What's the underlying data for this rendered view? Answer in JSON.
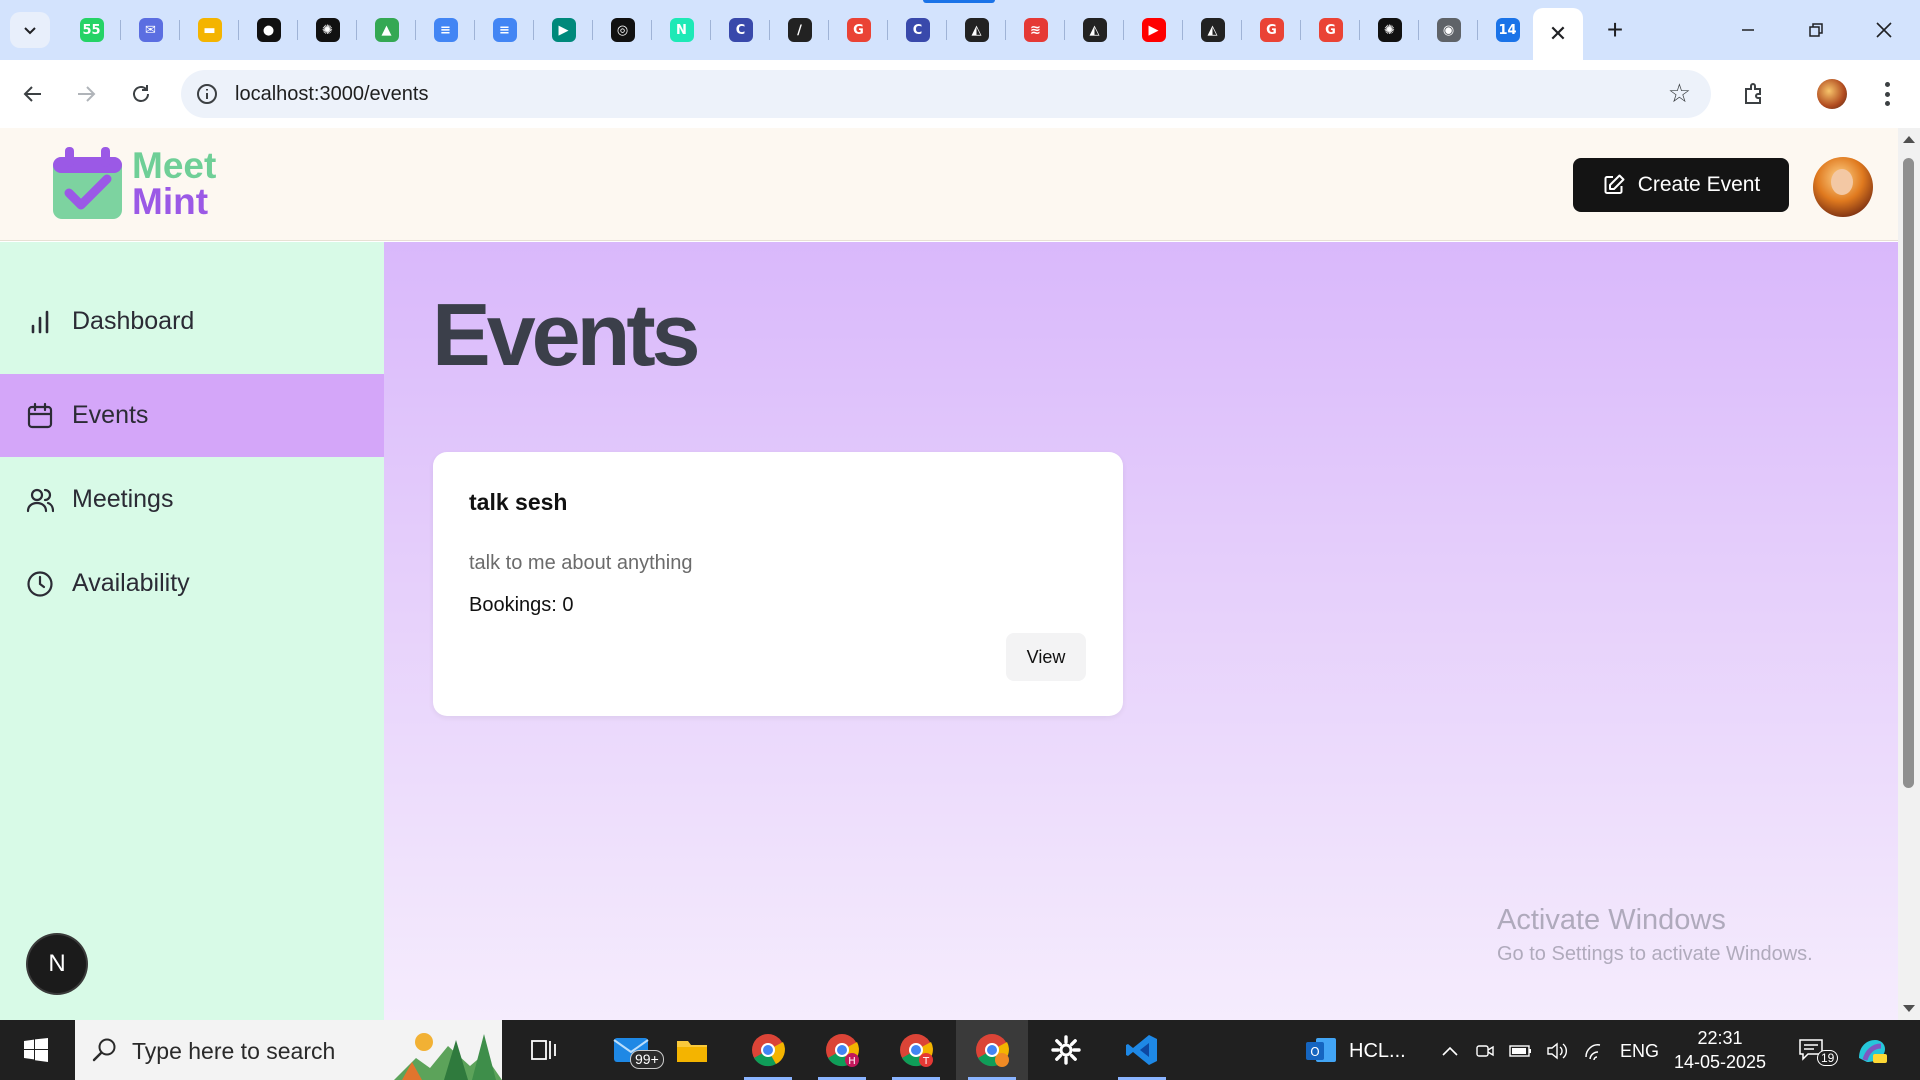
{
  "browser": {
    "tab_favicons": [
      {
        "name": "whatsapp",
        "color": "#25d366",
        "glyph": "55"
      },
      {
        "name": "mail",
        "color": "#5b6ee1",
        "glyph": "✉"
      },
      {
        "name": "keep",
        "color": "#f4b400",
        "glyph": "▬"
      },
      {
        "name": "mongodb",
        "color": "#111111",
        "glyph": "●"
      },
      {
        "name": "chatgpt",
        "color": "#111111",
        "glyph": "✺"
      },
      {
        "name": "drive",
        "color": "#34a853",
        "glyph": "▲"
      },
      {
        "name": "docs",
        "color": "#4285f4",
        "glyph": "≡"
      },
      {
        "name": "docs-2",
        "color": "#4285f4",
        "glyph": "≡"
      },
      {
        "name": "meet",
        "color": "#00897b",
        "glyph": "▶"
      },
      {
        "name": "github",
        "color": "#111111",
        "glyph": "◎"
      },
      {
        "name": "notion-n",
        "color": "#1de9b6",
        "glyph": "N"
      },
      {
        "name": "edge-c",
        "color": "#3949ab",
        "glyph": "C"
      },
      {
        "name": "pen",
        "color": "#222222",
        "glyph": "∕"
      },
      {
        "name": "google",
        "color": "#ea4335",
        "glyph": "G"
      },
      {
        "name": "edge-c-2",
        "color": "#3949ab",
        "glyph": "C"
      },
      {
        "name": "prisma",
        "color": "#222222",
        "glyph": "◭"
      },
      {
        "name": "brand-stripe",
        "color": "#e53935",
        "glyph": "≋"
      },
      {
        "name": "prisma-2",
        "color": "#222222",
        "glyph": "◭"
      },
      {
        "name": "youtube",
        "color": "#ff0000",
        "glyph": "▶"
      },
      {
        "name": "prisma-3",
        "color": "#222222",
        "glyph": "◭"
      },
      {
        "name": "google-2",
        "color": "#ea4335",
        "glyph": "G"
      },
      {
        "name": "google-3",
        "color": "#ea4335",
        "glyph": "G"
      },
      {
        "name": "chatgpt-2",
        "color": "#111111",
        "glyph": "✺"
      },
      {
        "name": "chrome",
        "color": "#5f6368",
        "glyph": "◉"
      },
      {
        "name": "calendar",
        "color": "#1a73e8",
        "glyph": "14"
      }
    ],
    "active_tab_close": "✕",
    "new_tab": "+",
    "url": "localhost:3000/events"
  },
  "app": {
    "logo_line1": "Meet",
    "logo_line2": "Mint",
    "create_event_label": "Create Event",
    "colors": {
      "mint": "#6fcf97",
      "purple": "#9b59e6",
      "sidebar_bg": "#d8fae7",
      "active_item": "#d4a6f9"
    }
  },
  "sidebar": {
    "items": [
      {
        "label": "Dashboard",
        "icon": "bar-chart-icon",
        "active": false
      },
      {
        "label": "Events",
        "icon": "calendar-icon",
        "active": true
      },
      {
        "label": "Meetings",
        "icon": "users-icon",
        "active": false
      },
      {
        "label": "Availability",
        "icon": "clock-icon",
        "active": false
      }
    ],
    "badge_letter": "N"
  },
  "main": {
    "page_title": "Events",
    "events": [
      {
        "title": "talk sesh",
        "description": "talk to me about anything",
        "bookings": "Bookings: 0",
        "view_label": "View"
      }
    ],
    "watermark_title": "Activate Windows",
    "watermark_sub": "Go to Settings to activate Windows."
  },
  "taskbar": {
    "search_placeholder": "Type here to search",
    "mail_badge": "99+",
    "outlook_label": "HCL...",
    "language": "ENG",
    "time": "22:31",
    "date": "14-05-2025",
    "notification_count": "19"
  }
}
